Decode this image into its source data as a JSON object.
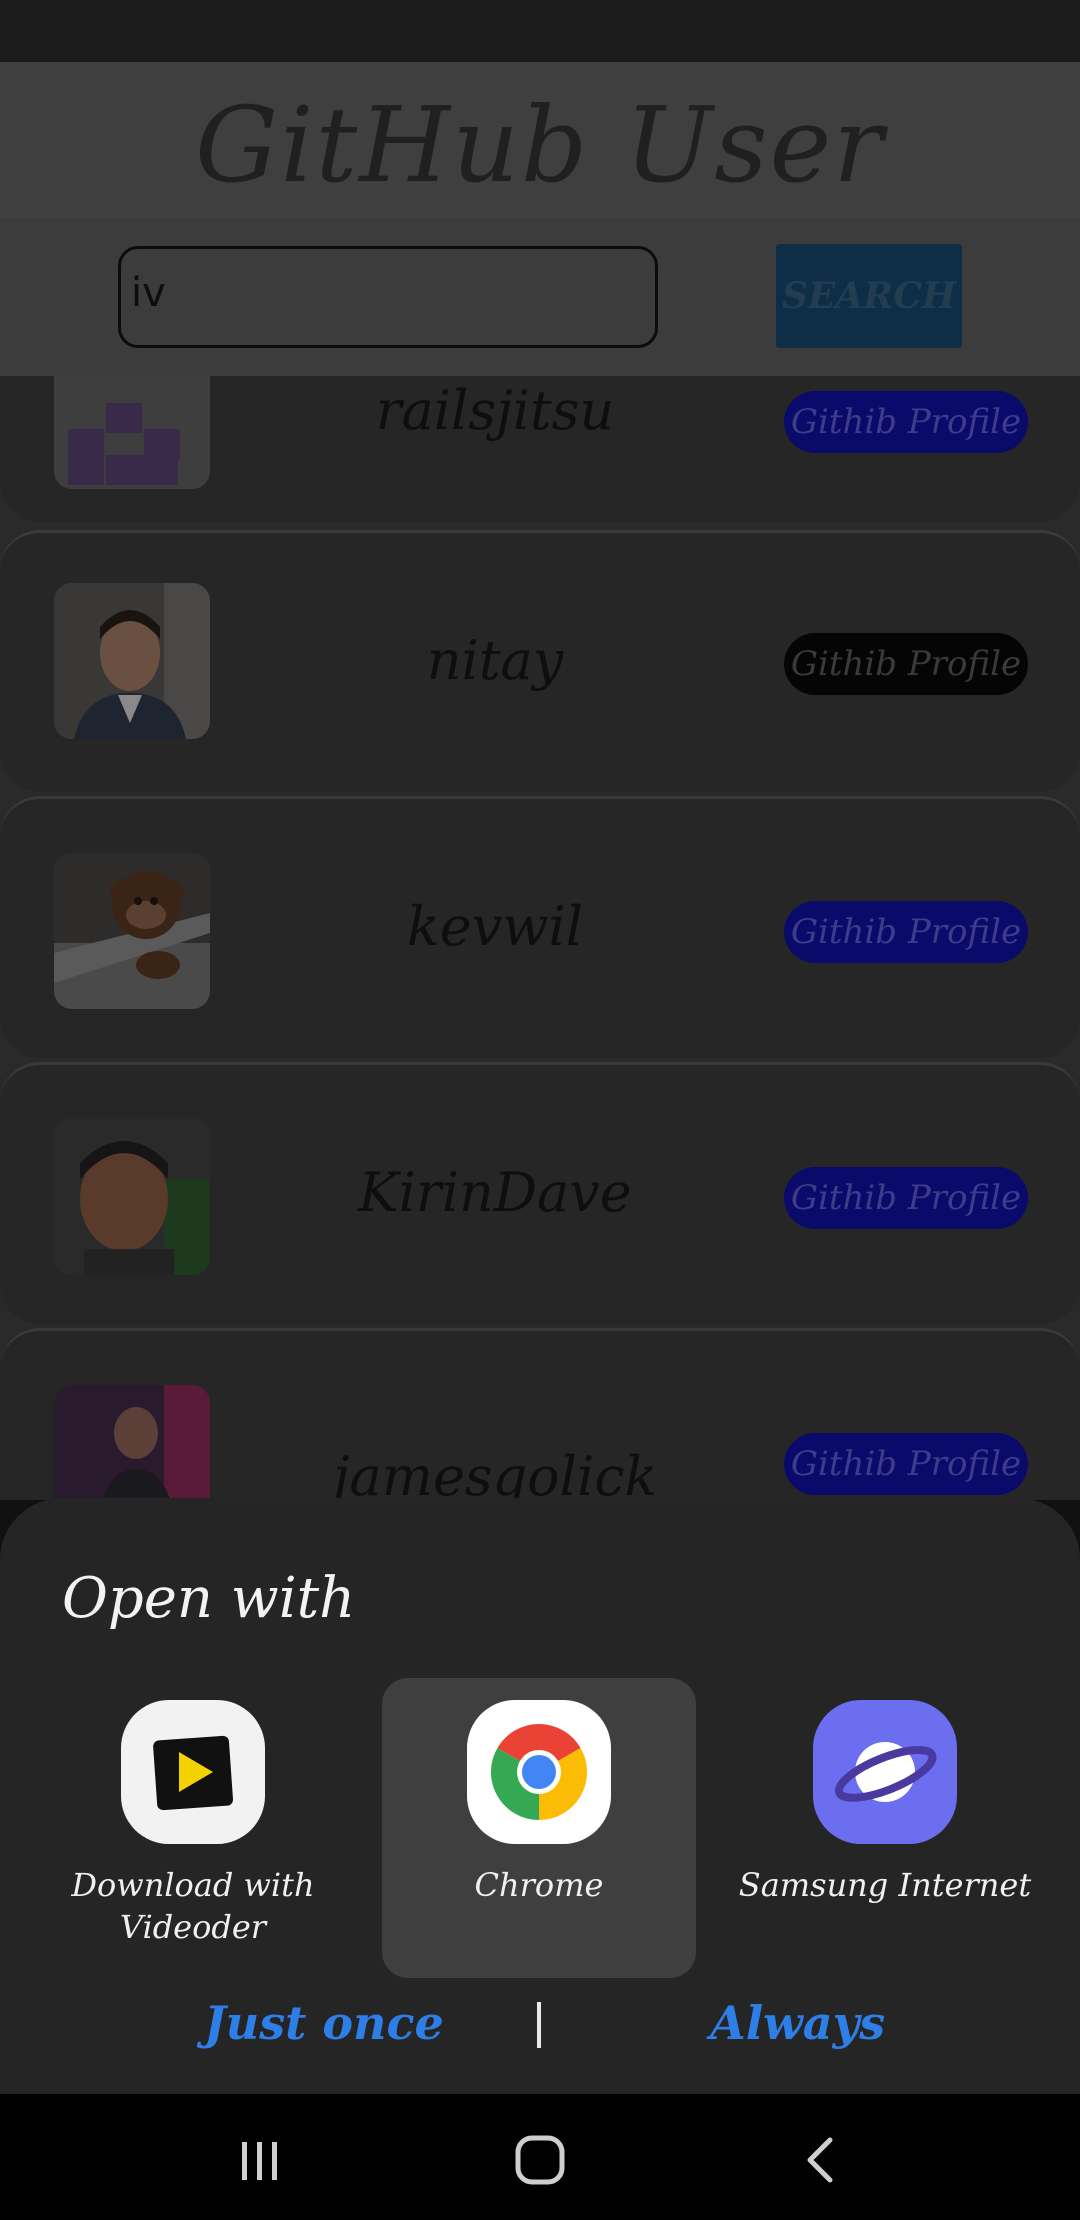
{
  "app": {
    "title": "GitHub User",
    "search_value": "iv",
    "search_button": "SEARCH"
  },
  "users": [
    {
      "login": "railsjitsu",
      "button": "Githib Profile"
    },
    {
      "login": "nitay",
      "button": "Githib Profile"
    },
    {
      "login": "kevwil",
      "button": "Githib Profile"
    },
    {
      "login": "KirinDave",
      "button": "Githib Profile"
    },
    {
      "login": "jamesgolick",
      "button": "Githib Profile"
    }
  ],
  "sheet": {
    "title": "Open with",
    "apps": [
      {
        "label": "Download with Videoder",
        "icon": "videoder-icon"
      },
      {
        "label": "Chrome",
        "icon": "chrome-icon",
        "selected": true
      },
      {
        "label": "Samsung Internet",
        "icon": "samsung-internet-icon"
      }
    ],
    "just_once": "Just once",
    "always": "Always"
  },
  "colors": {
    "accent": "#2e7ee8",
    "sheet_bg": "#252525"
  }
}
